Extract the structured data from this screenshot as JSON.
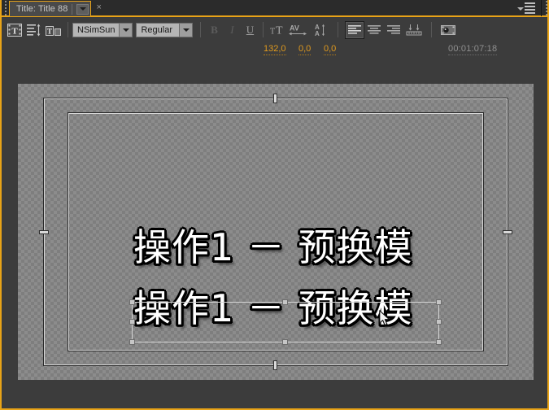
{
  "window": {
    "tab_label": "Title: Title 88",
    "close_label": "×"
  },
  "toolbar": {
    "tool_icons": [
      {
        "name": "title-tool-icon",
        "label": "T"
      },
      {
        "name": "line-spacing-icon",
        "label": ""
      },
      {
        "name": "text-scale-icon",
        "label": ""
      }
    ],
    "font_family": "NSimSun",
    "font_style": "Regular",
    "bold_label": "B",
    "italic_label": "I",
    "underline_label": "U",
    "font_size_value": "132,0",
    "kerning_value": "0,0",
    "tracking_value": "0,0",
    "timecode": "00:01:07:18",
    "align_left_active": true
  },
  "canvas": {
    "text_line_1": "操作1 － 预换模",
    "text_line_2": "操作1 － 预换模"
  },
  "colors": {
    "accent": "#e8a317",
    "panel_bg": "#3c3c3c",
    "value_orange": "#e09a1e",
    "timecode_gray": "#8f8f8f"
  }
}
